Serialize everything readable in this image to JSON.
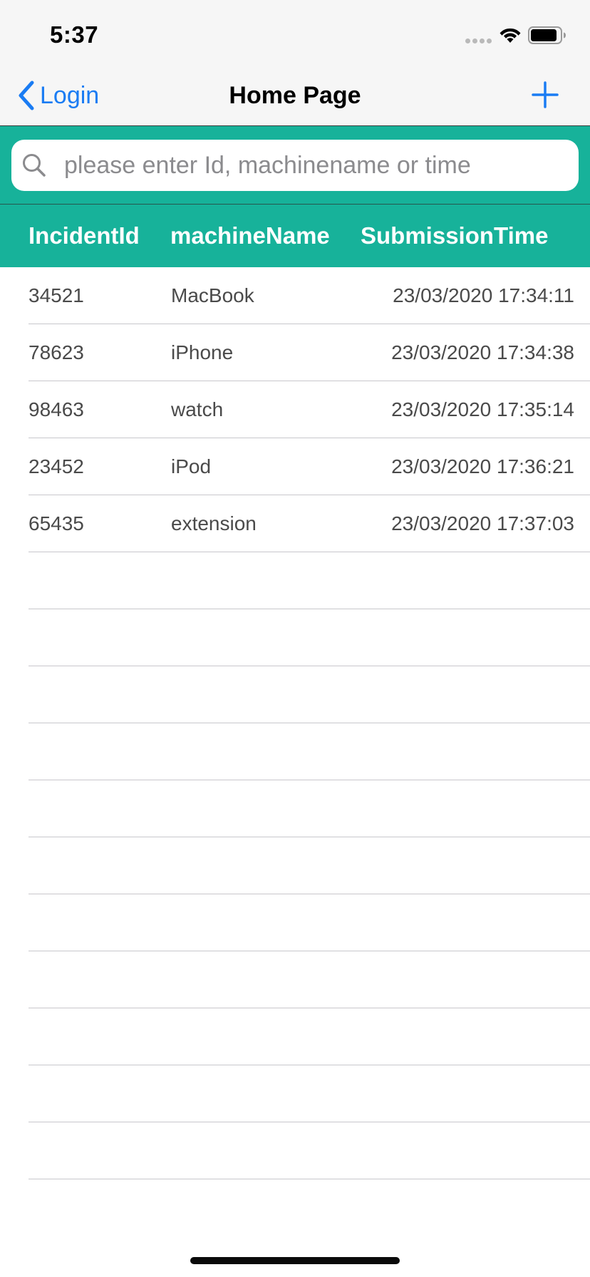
{
  "status_bar": {
    "time": "5:37"
  },
  "nav": {
    "back_label": "Login",
    "title": "Home Page",
    "add_icon": "plus-icon"
  },
  "search": {
    "placeholder": "please enter Id, machinename or time",
    "value": ""
  },
  "table": {
    "headers": [
      "IncidentId",
      "machineName",
      "SubmissionTime"
    ],
    "rows": [
      {
        "id": "34521",
        "machine": "MacBook",
        "time": "23/03/2020 17:34:11"
      },
      {
        "id": "78623",
        "machine": "iPhone",
        "time": "23/03/2020 17:34:38"
      },
      {
        "id": "98463",
        "machine": "watch",
        "time": "23/03/2020 17:35:14"
      },
      {
        "id": "23452",
        "machine": "iPod",
        "time": "23/03/2020 17:36:21"
      },
      {
        "id": "65435",
        "machine": "extension",
        "time": "23/03/2020 17:37:03"
      }
    ],
    "empty_rows": 11
  },
  "colors": {
    "accent": "#17b29a",
    "link": "#1a7cf3",
    "nav_background": "#f6f6f6",
    "separator": "#c8c7cc",
    "cell_text": "#4a4a4a"
  },
  "icons": {
    "back": "chevron-left-icon",
    "search": "magnifying-glass-icon",
    "wifi": "wifi-icon",
    "battery": "battery-icon",
    "signal": "cellular-signal-icon"
  }
}
